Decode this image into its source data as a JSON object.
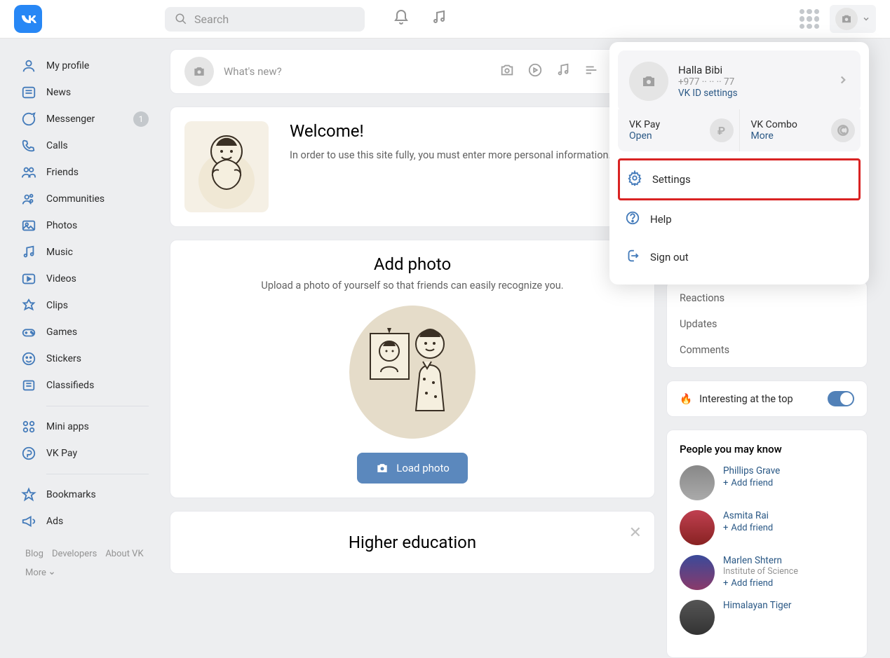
{
  "search_placeholder": "Search",
  "sidebar": {
    "items": [
      {
        "label": "My profile"
      },
      {
        "label": "News"
      },
      {
        "label": "Messenger",
        "badge": "1"
      },
      {
        "label": "Calls"
      },
      {
        "label": "Friends"
      },
      {
        "label": "Communities"
      },
      {
        "label": "Photos"
      },
      {
        "label": "Music"
      },
      {
        "label": "Videos"
      },
      {
        "label": "Clips"
      },
      {
        "label": "Games"
      },
      {
        "label": "Stickers"
      },
      {
        "label": "Classifieds"
      }
    ],
    "items2": [
      {
        "label": "Mini apps"
      },
      {
        "label": "VK Pay"
      }
    ],
    "items3": [
      {
        "label": "Bookmarks"
      },
      {
        "label": "Ads"
      }
    ],
    "footer": {
      "blog": "Blog",
      "developers": "Developers",
      "about": "About VK",
      "more": "More"
    }
  },
  "post": {
    "placeholder": "What's new?"
  },
  "welcome": {
    "title": "Welcome!",
    "text": "In order to use this site fully, you must enter more personal information."
  },
  "addphoto": {
    "title": "Add photo",
    "text": "Upload a photo of yourself so that friends can easily recognize you.",
    "button": "Load photo"
  },
  "higher_ed": {
    "title": "Higher education"
  },
  "right_hidden": {
    "reactions": "Reactions",
    "updates": "Updates",
    "comments": "Comments"
  },
  "interesting": {
    "label": "Interesting at the top"
  },
  "pymk": {
    "title": "People you may know",
    "add": "Add friend",
    "items": [
      {
        "name": "Phillips Grave",
        "sub": ""
      },
      {
        "name": "Asmita Rai",
        "sub": ""
      },
      {
        "name": "Marlen Shtern",
        "sub": "Institute of Science"
      },
      {
        "name": "Himalayan Tiger",
        "sub": ""
      }
    ]
  },
  "dropdown": {
    "name": "Halla Bibi",
    "phone": "+977 ·· ·· ·· 77",
    "vkid": "VK ID settings",
    "vkpay": {
      "title": "VK Pay",
      "action": "Open"
    },
    "vkcombo": {
      "title": "VK Combo",
      "action": "More"
    },
    "settings": "Settings",
    "help": "Help",
    "signout": "Sign out"
  }
}
